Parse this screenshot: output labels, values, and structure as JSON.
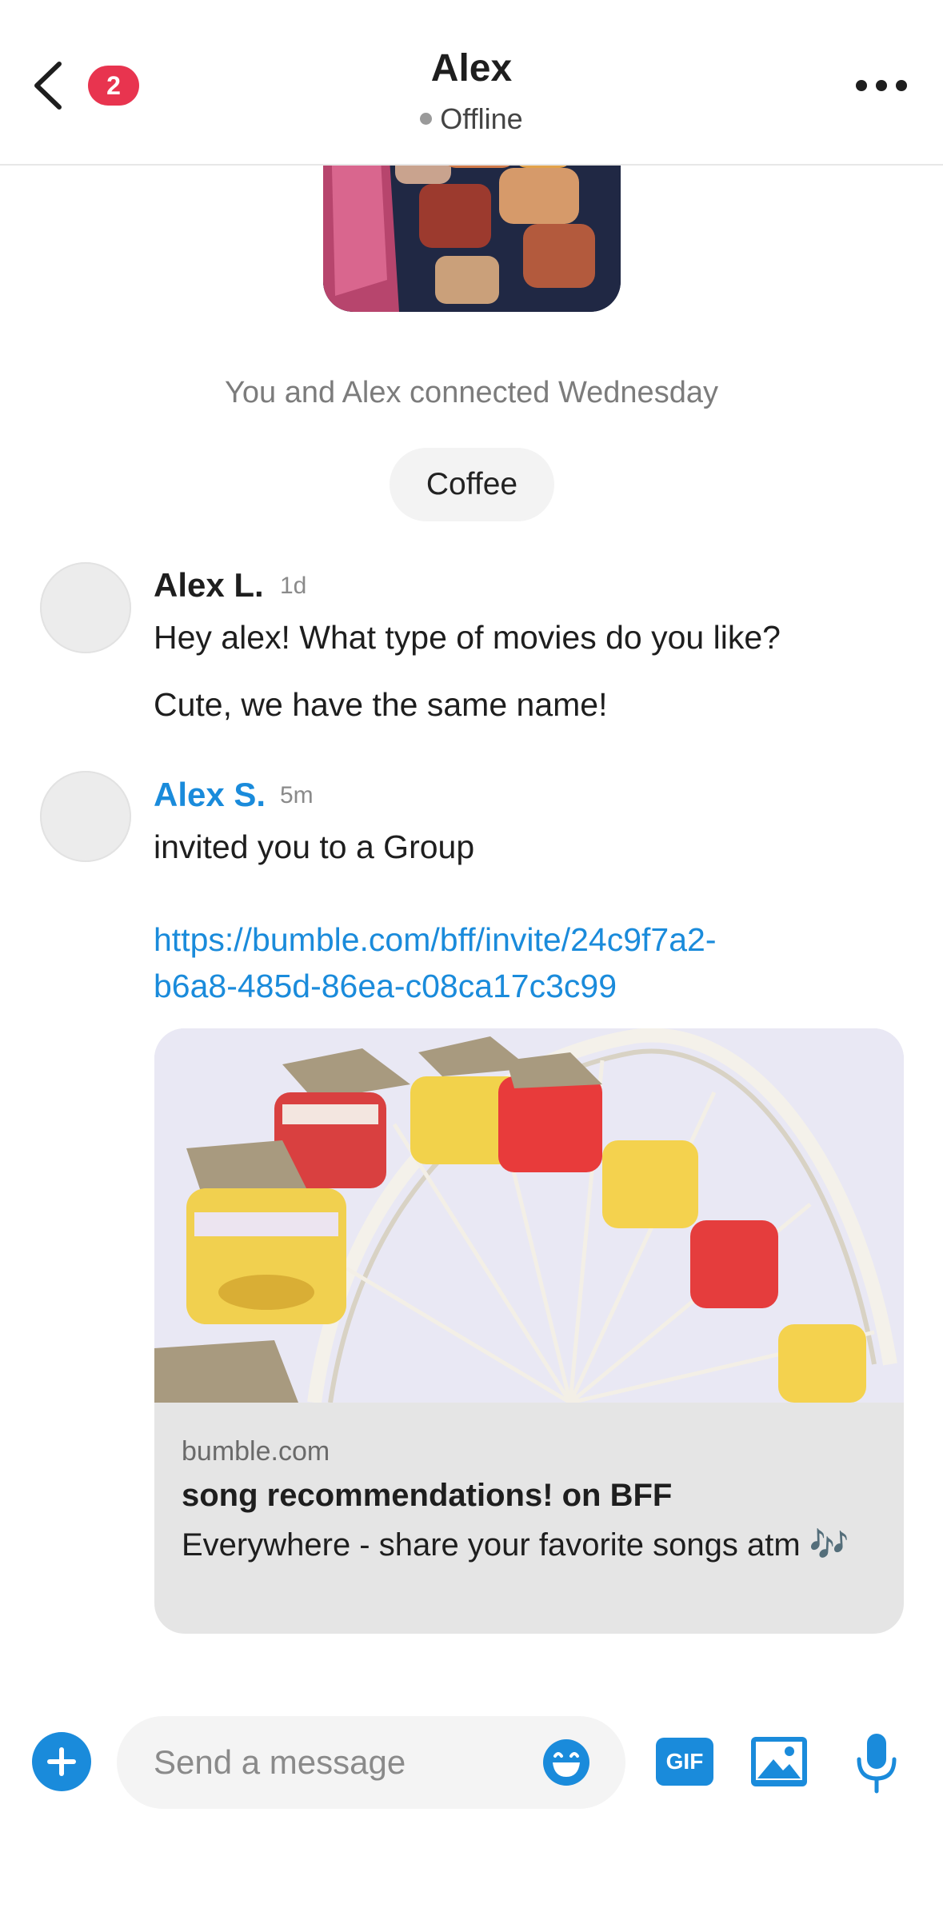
{
  "header": {
    "title": "Alex",
    "status": "Offline",
    "badge_count": "2"
  },
  "chat": {
    "connected_text": "You and Alex connected Wednesday",
    "interest_chip": "Coffee",
    "messages": [
      {
        "sender": "Alex L.",
        "time": "1d",
        "lines": [
          "Hey alex! What type of movies do you like?",
          "Cute, we have the same name!"
        ]
      },
      {
        "sender": "Alex S.",
        "time": "5m",
        "text": "invited you to a Group",
        "link_line1": "https://bumble.com/bff/invite/24c9f7a2-",
        "link_line2": "b6a8-485d-86ea-c08ca17c3c99"
      }
    ],
    "link_preview": {
      "domain": "bumble.com",
      "title": "song recommendations! on BFF",
      "description": "Everywhere - share your favorite songs atm 🎶"
    }
  },
  "composer": {
    "placeholder": "Send a message",
    "gif_label": "GIF"
  },
  "colors": {
    "accent": "#1a8bdb",
    "badge": "#e8344f"
  }
}
